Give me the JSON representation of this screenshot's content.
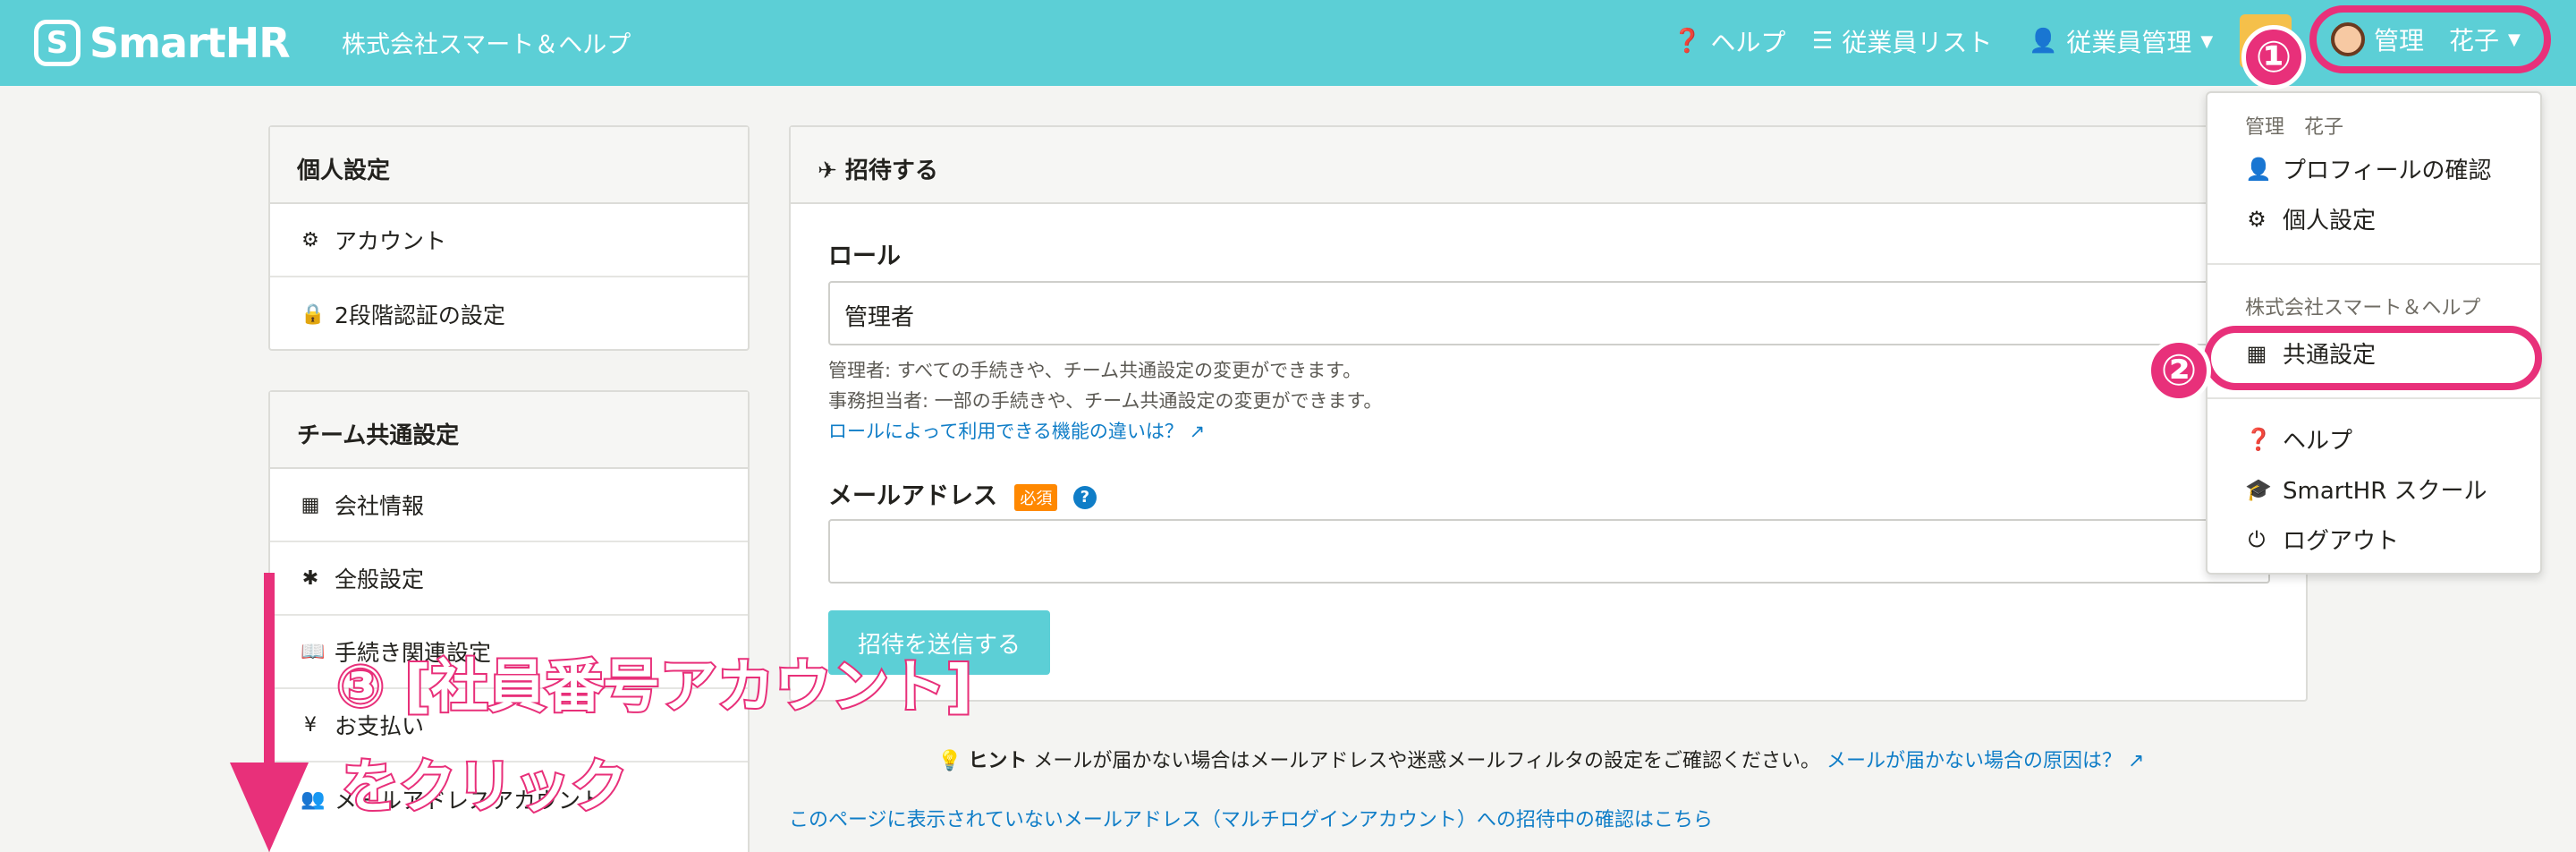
{
  "header": {
    "logo_mark": "S",
    "logo_text": "SmartHR",
    "company": "株式会社スマート＆ヘルプ",
    "nav": [
      {
        "icon": "question-circle-icon",
        "label": "ヘルプ"
      },
      {
        "icon": "list-icon",
        "label": "従業員リスト"
      },
      {
        "icon": "user-icon",
        "label": "従業員管理"
      }
    ],
    "user_name": "管理　花子"
  },
  "sidebar": {
    "personal": {
      "title": "個人設定",
      "items": [
        {
          "icon": "gear-icon",
          "label": "アカウント"
        },
        {
          "icon": "lock-icon",
          "label": "2段階認証の設定"
        }
      ]
    },
    "team": {
      "title": "チーム共通設定",
      "items": [
        {
          "icon": "building-icon",
          "label": "会社情報"
        },
        {
          "icon": "asterisk-icon",
          "label": "全般設定"
        },
        {
          "icon": "book-icon",
          "label": "手続き関連設定"
        },
        {
          "icon": "yen-icon",
          "label": "お支払い"
        },
        {
          "icon": "users-icon",
          "label": "メールアドレスアカウント"
        }
      ]
    }
  },
  "main": {
    "title": "招待する",
    "role_label": "ロール",
    "role_value": "管理者",
    "role_help_1": "管理者: すべての手続きや、チーム共通設定の変更ができます。",
    "role_help_2": "事務担当者: 一部の手続きや、チーム共通設定の変更ができます。",
    "role_link": "ロールによって利用できる機能の違いは？",
    "email_label": "メールアドレス",
    "required_badge": "必須",
    "submit_label": "招待を送信する"
  },
  "hint": {
    "prefix": "ヒント",
    "text": "メールが届かない場合はメールアドレスや迷惑メールフィルタの設定をご確認ください。",
    "link": "メールが届かない場合の原因は？"
  },
  "bottom_link": "このページに表示されていないメールアドレス（マルチログインアカウント）への招待中の確認はこちら",
  "dropdown": {
    "user_header": "管理　花子",
    "profile": "プロフィールの確認",
    "personal_settings": "個人設定",
    "company_header": "株式会社スマート＆ヘルプ",
    "common_settings": "共通設定",
    "help": "ヘルプ",
    "school": "SmartHR スクール",
    "logout": "ログアウト"
  },
  "annotations": {
    "step1": "①",
    "step2": "②",
    "step3_line1": "③ [社員番号アカウント]",
    "step3_line2": "をクリック"
  },
  "colors": {
    "header": "#5ccfd6",
    "accent": "#e8307a",
    "link": "#0f7dc7",
    "required": "#ff8800"
  }
}
